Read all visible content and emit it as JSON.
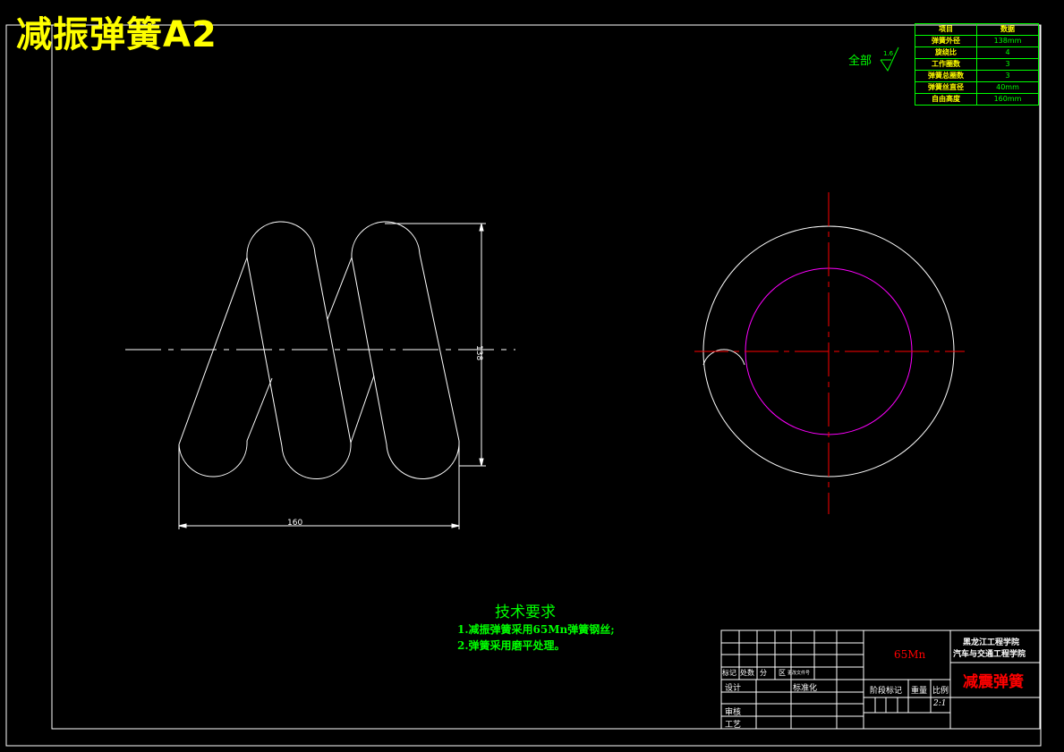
{
  "drawing_title": "减振弹簧A2",
  "surface_finish": {
    "label": "全部",
    "value": "1.6"
  },
  "param_table": {
    "header": [
      "项目",
      "数据"
    ],
    "rows": [
      [
        "弹簧外径",
        "138mm"
      ],
      [
        "旋绕比",
        "4"
      ],
      [
        "工作圈数",
        "3"
      ],
      [
        "弹簧总圈数",
        "3"
      ],
      [
        "弹簧丝直径",
        "40mm"
      ],
      [
        "自由高度",
        "160mm"
      ]
    ]
  },
  "dimensions": {
    "height": "138",
    "length": "160"
  },
  "tech_requirements": {
    "title": "技术要求",
    "items": [
      "1.减振弹簧采用65Mn弹簧钢丝;",
      "2.弹簧采用磨平处理。"
    ]
  },
  "title_block": {
    "material": "65Mn",
    "school_line1": "黑龙江工程学院",
    "school_line2": "汽车与交通工程学院",
    "part_name": "减震弹簧",
    "mark_row": [
      "标记",
      "处数",
      "分",
      "区",
      "更改文件号"
    ],
    "design_label": "设计",
    "standard_label": "标准化",
    "review_label": "审核",
    "process_label": "工艺",
    "stage_label": "阶段标记",
    "weight_label": "重量",
    "scale_label": "比例",
    "scale_value": "2:1"
  },
  "colors": {
    "background": "#000000",
    "line": "#ffffff",
    "center_line": "#ff0000",
    "inner_circle": "#ff00ff",
    "text_green": "#00ff00",
    "title_yellow": "#ffff00",
    "part_red": "#ff0000"
  }
}
